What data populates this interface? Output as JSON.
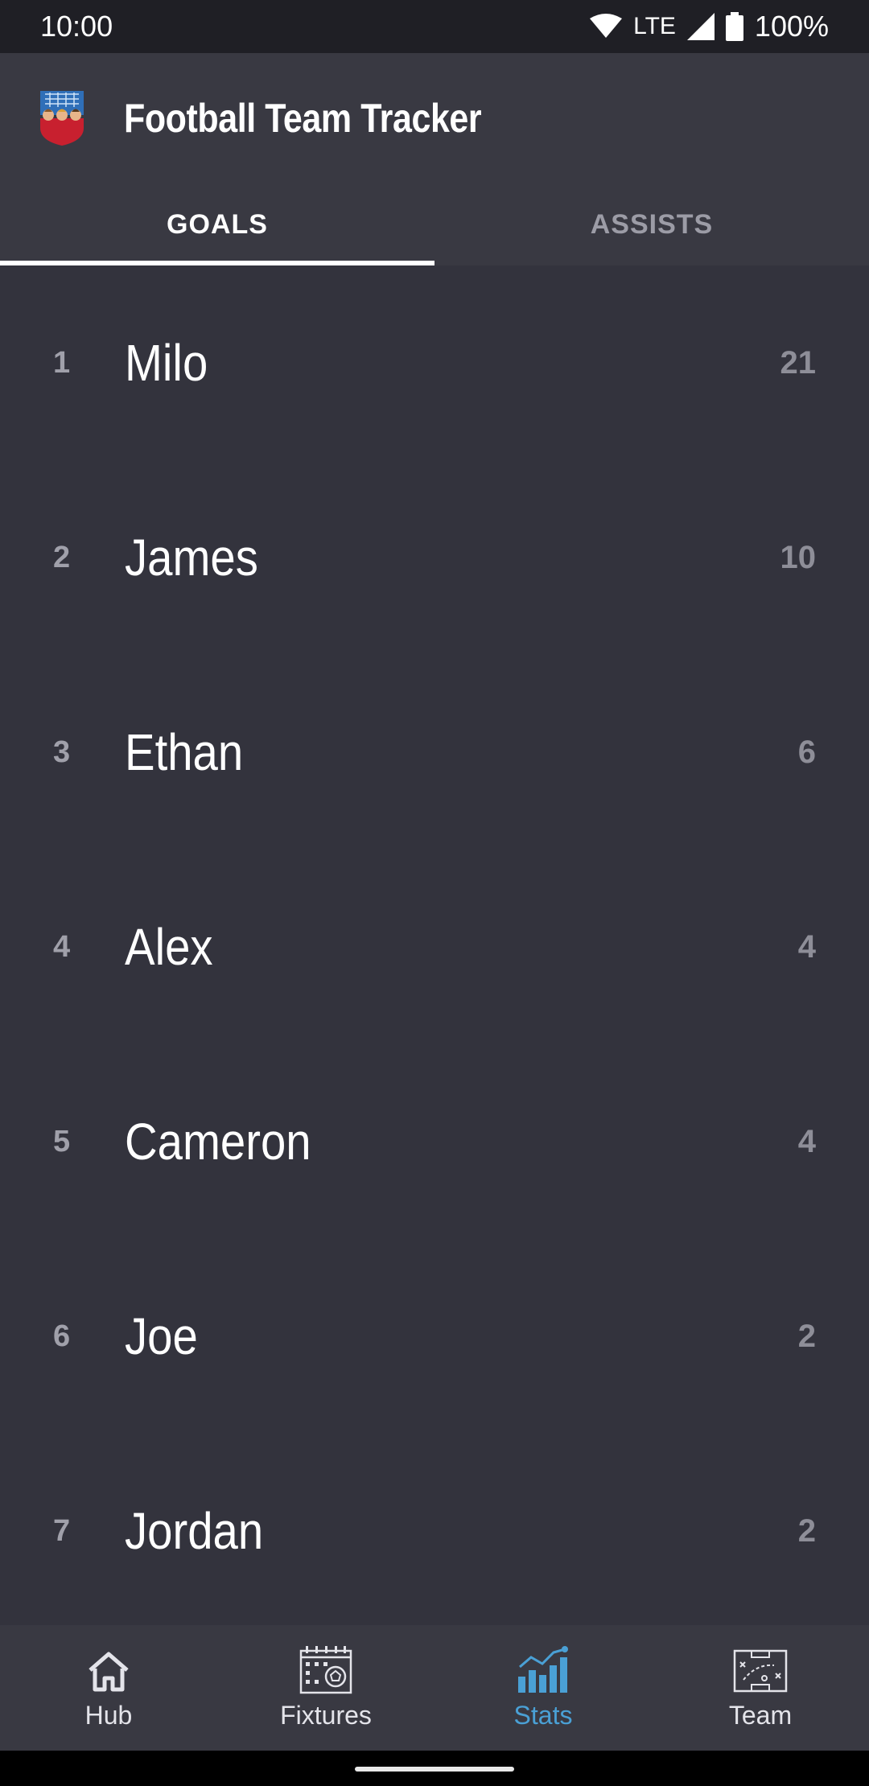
{
  "status_bar": {
    "time": "10:00",
    "network": "LTE",
    "battery": "100%",
    "icons": [
      "wifi-icon",
      "signal-icon",
      "battery-icon"
    ]
  },
  "app": {
    "title": "Football Team Tracker",
    "logo_icon": "team-crest-icon"
  },
  "tabs": [
    {
      "label": "GOALS",
      "selected": true
    },
    {
      "label": "ASSISTS",
      "selected": false
    }
  ],
  "leaderboard": [
    {
      "rank": "1",
      "name": "Milo",
      "value": "21"
    },
    {
      "rank": "2",
      "name": "James",
      "value": "10"
    },
    {
      "rank": "3",
      "name": "Ethan",
      "value": "6"
    },
    {
      "rank": "4",
      "name": "Alex",
      "value": "4"
    },
    {
      "rank": "5",
      "name": "Cameron",
      "value": "4"
    },
    {
      "rank": "6",
      "name": "Joe",
      "value": "2"
    },
    {
      "rank": "7",
      "name": "Jordan",
      "value": "2"
    }
  ],
  "bottom_nav": [
    {
      "label": "Hub",
      "icon": "home-icon",
      "active": false
    },
    {
      "label": "Fixtures",
      "icon": "calendar-icon",
      "active": false
    },
    {
      "label": "Stats",
      "icon": "bar-chart-icon",
      "active": true
    },
    {
      "label": "Team",
      "icon": "tactics-board-icon",
      "active": false
    }
  ],
  "colors": {
    "background": "#33333d",
    "app_bar": "#393942",
    "accent": "#4aa0d5",
    "status_bar": "#1f1f25"
  }
}
